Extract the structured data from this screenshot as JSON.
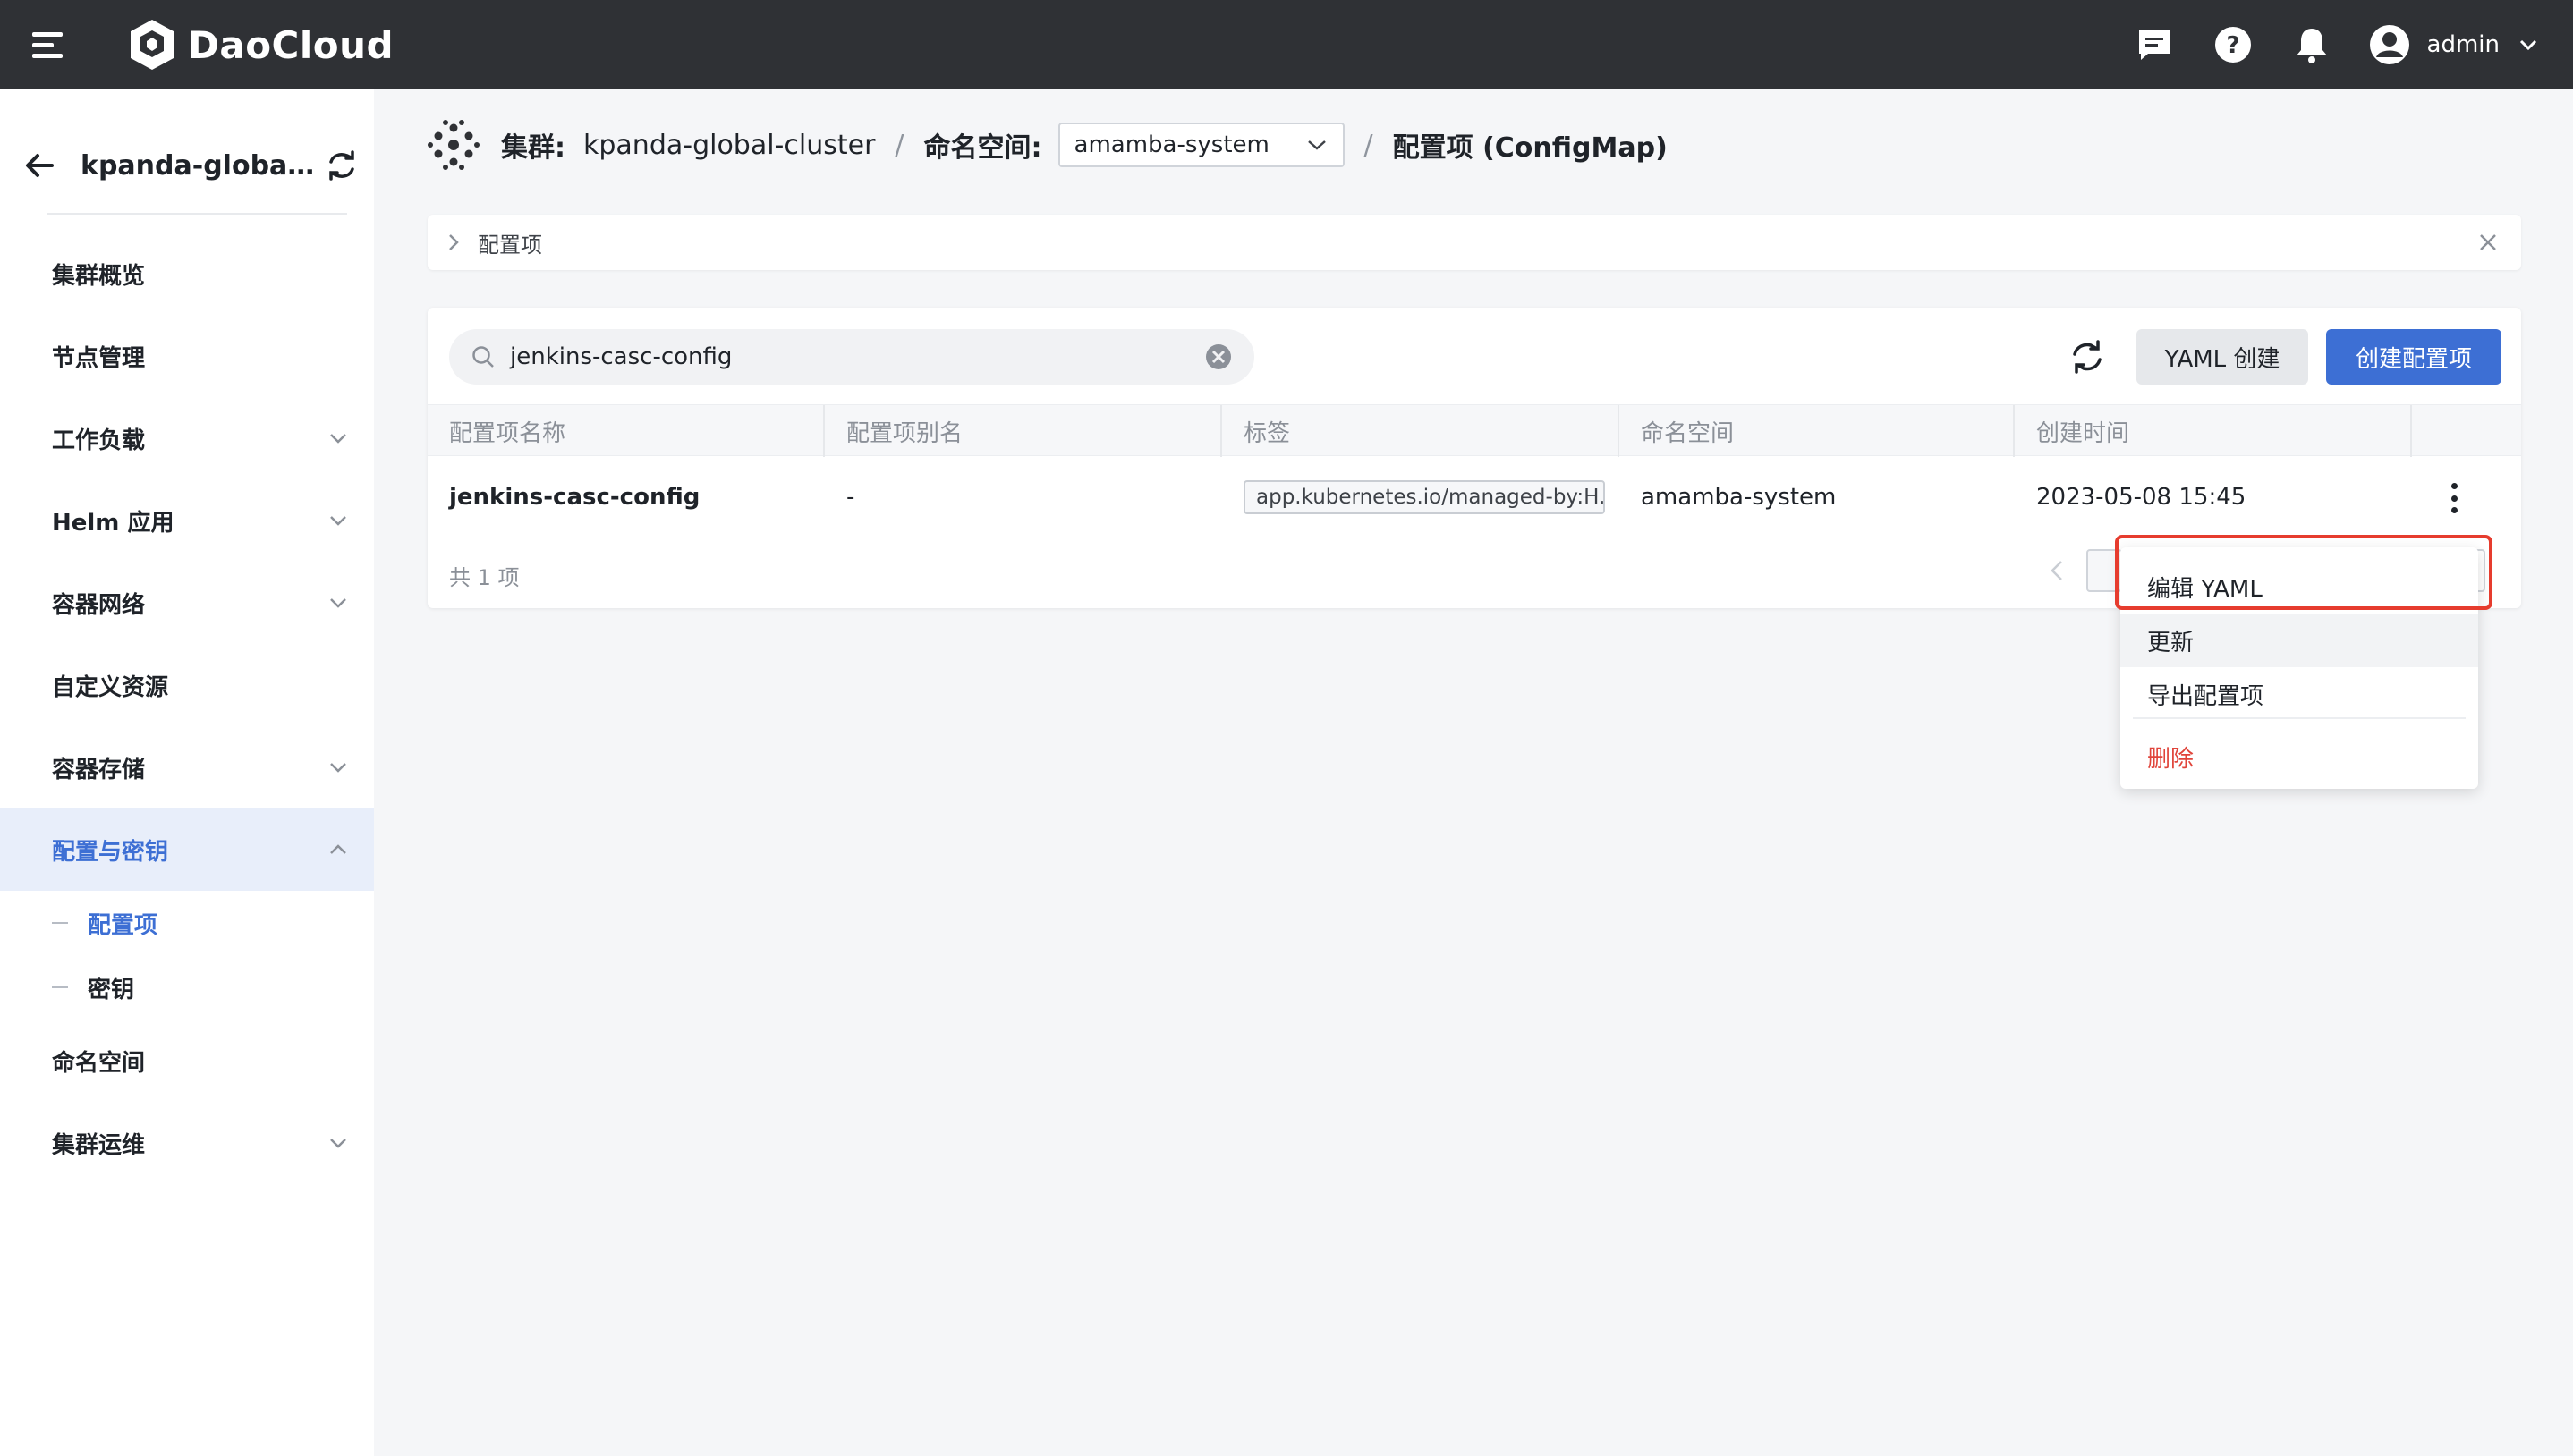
{
  "app": {
    "brand": "DaoCloud",
    "user": "admin"
  },
  "sidebar": {
    "cluster_name": "kpanda-global-cl...",
    "items": [
      {
        "label": "集群概览",
        "expandable": false
      },
      {
        "label": "节点管理",
        "expandable": false
      },
      {
        "label": "工作负载",
        "expandable": true
      },
      {
        "label": "Helm 应用",
        "expandable": true
      },
      {
        "label": "容器网络",
        "expandable": true
      },
      {
        "label": "自定义资源",
        "expandable": false
      },
      {
        "label": "容器存储",
        "expandable": true
      },
      {
        "label": "配置与密钥",
        "expandable": true,
        "expanded": true
      },
      {
        "label": "命名空间",
        "expandable": false
      },
      {
        "label": "集群运维",
        "expandable": true
      }
    ],
    "sub_items": [
      {
        "label": "配置项"
      },
      {
        "label": "密钥"
      }
    ]
  },
  "breadcrumb": {
    "cluster_label": "集群:",
    "cluster_value": "kpanda-global-cluster",
    "sep1": "/",
    "ns_label": "命名空间:",
    "ns_value": "amamba-system",
    "sep2": "/",
    "page": "配置项 (ConfigMap)"
  },
  "infobar": {
    "label": "配置项"
  },
  "toolbar": {
    "search_value": "jenkins-casc-config",
    "yaml_create": "YAML 创建",
    "create": "创建配置项"
  },
  "table": {
    "columns": [
      "配置项名称",
      "配置项别名",
      "标签",
      "命名空间",
      "创建时间"
    ],
    "rows": [
      {
        "name": "jenkins-casc-config",
        "alias": "-",
        "label": "app.kubernetes.io/managed-by:H...",
        "namespace": "amamba-system",
        "created": "2023-05-08 15:45"
      }
    ],
    "footer": "共 1 项"
  },
  "menu": {
    "items": [
      "编辑 YAML",
      "更新",
      "导出配置项",
      "删除"
    ]
  },
  "colors": {
    "accent": "#3d6fd4",
    "danger": "#e0443a",
    "topbar": "#2f3135",
    "highlight": "#e63c2e"
  }
}
